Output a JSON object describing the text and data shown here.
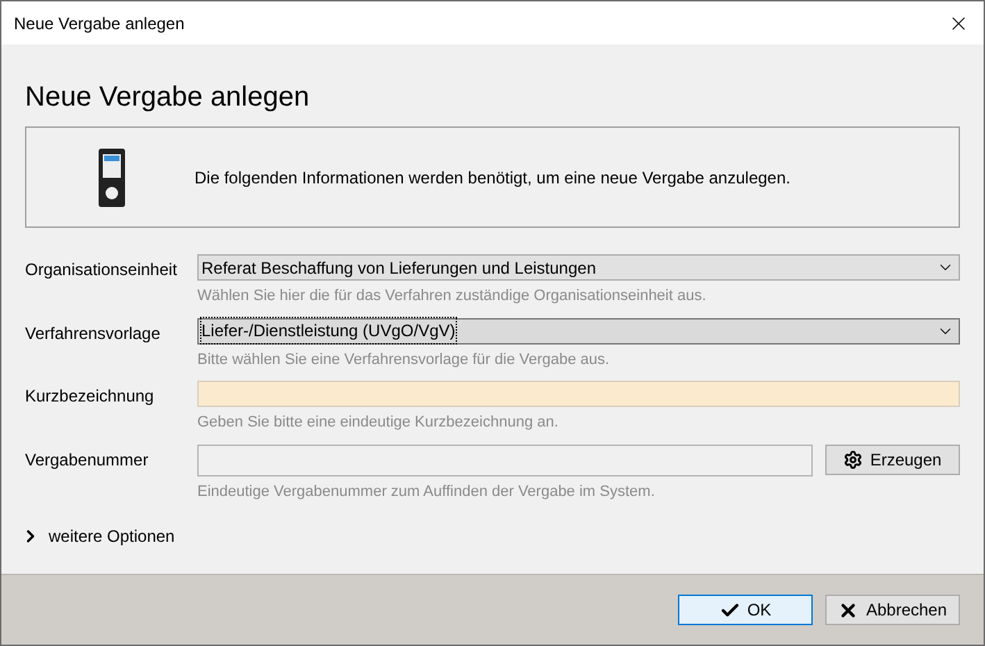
{
  "window": {
    "title": "Neue Vergabe anlegen"
  },
  "heading": "Neue Vergabe anlegen",
  "info": "Die folgenden Informationen werden benötigt, um eine neue Vergabe anzulegen.",
  "fields": [
    {
      "kind": "select",
      "label": "Organisationseinheit",
      "value": "Referat Beschaffung von Lieferungen und Leistungen",
      "help": "Wählen Sie hier die für das Verfahren zuständige Organisationseinheit aus.",
      "focused": false
    },
    {
      "kind": "select",
      "label": "Verfahrensvorlage",
      "value": "Liefer-/Dienstleistung (UVgO/VgV)",
      "help": "Bitte wählen Sie eine Verfahrensvorlage für die Vergabe aus.",
      "focused": true
    },
    {
      "kind": "required",
      "label": "Kurzbezeichnung",
      "help": "Geben Sie bitte eine eindeutige Kurzbezeichnung an."
    },
    {
      "kind": "generate",
      "label": "Vergabenummer",
      "button": "Erzeugen",
      "help": "Eindeutige Vergabenummer zum Auffinden der Vergabe im System."
    }
  ],
  "more_options": {
    "label": "weitere Optionen",
    "expanded": false
  },
  "buttons": [
    {
      "kind": "ok",
      "label": "OK",
      "default": true
    },
    {
      "kind": "cancel",
      "label": "Abbrechen",
      "default": false
    }
  ]
}
